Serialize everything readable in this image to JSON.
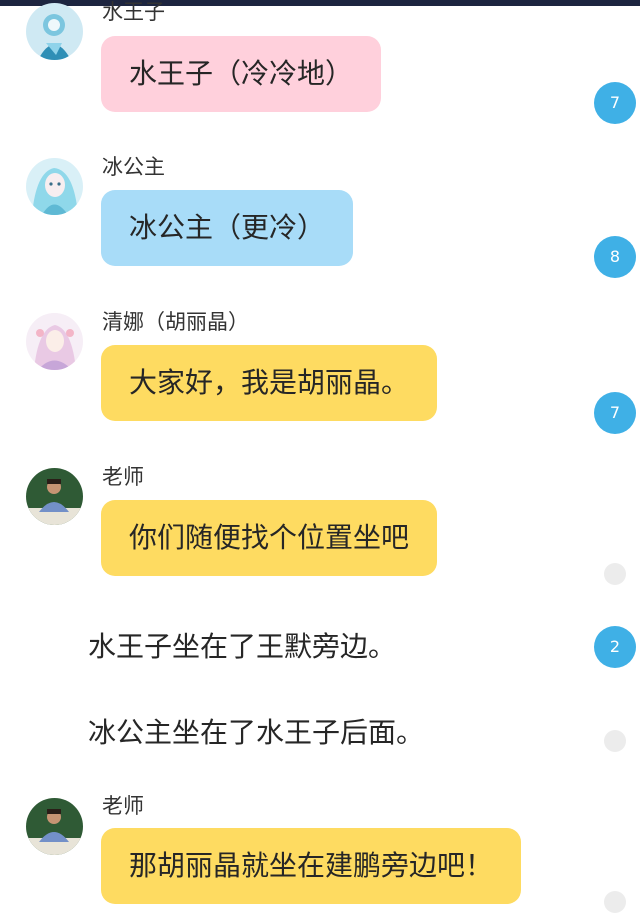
{
  "colors": {
    "pink_bubble": "#ffd0dc",
    "blue_bubble": "#a8dcf8",
    "yellow_bubble": "#fedb61",
    "badge": "#3fb0e6",
    "badge_empty": "#ececec",
    "top_bar": "#1d2540"
  },
  "messages": [
    {
      "name": "水王子",
      "text": "水王子（冷冷地）",
      "bubble": "pink",
      "avatar_icon": "water-prince-avatar-icon",
      "count": "7"
    },
    {
      "name": "冰公主",
      "text": "冰公主（更冷）",
      "bubble": "blue",
      "avatar_icon": "ice-princess-avatar-icon",
      "count": "8"
    },
    {
      "name": "清娜（胡丽晶）",
      "text": "大家好，我是胡丽晶。",
      "bubble": "yellow",
      "avatar_icon": "qingna-avatar-icon",
      "count": "7"
    },
    {
      "name": "老师",
      "text": "你们随便找个位置坐吧",
      "bubble": "yellow",
      "avatar_icon": "teacher-avatar-icon",
      "count": ""
    }
  ],
  "narrations": [
    {
      "text": "水王子坐在了王默旁边。",
      "count": "2"
    },
    {
      "text": "冰公主坐在了水王子后面。",
      "count": ""
    }
  ],
  "last_message": {
    "name": "老师",
    "text": "那胡丽晶就坐在建鹏旁边吧！",
    "bubble": "yellow",
    "avatar_icon": "teacher-avatar-icon",
    "count": ""
  }
}
